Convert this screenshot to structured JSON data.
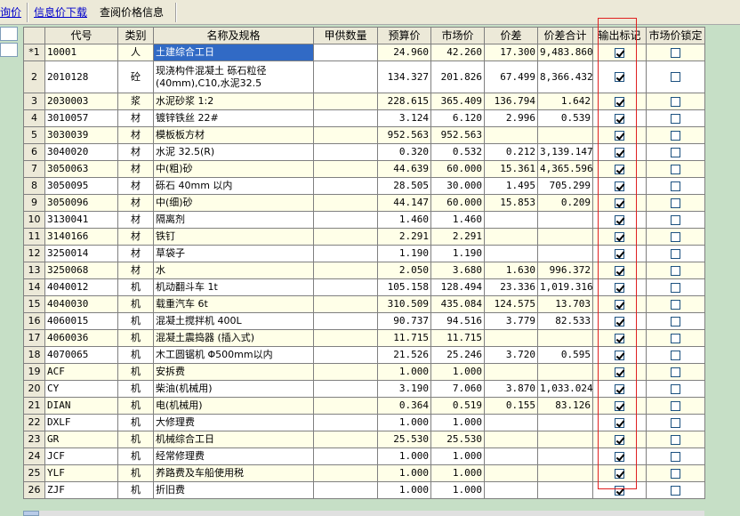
{
  "toolbar": {
    "link1": "询价",
    "link2": "信息价下载",
    "label3": "查阅价格信息"
  },
  "columns": [
    "代号",
    "类别",
    "名称及规格",
    "甲供数量",
    "预算价",
    "市场价",
    "价差",
    "价差合计",
    "输出标记",
    "市场价锁定"
  ],
  "rows": [
    {
      "num": "*1",
      "code": "10001",
      "cat": "人",
      "name": "土建综合工日",
      "budget": "24.960",
      "market": "42.260",
      "diff": "17.300",
      "total": "9,483.860",
      "output": true,
      "lock": false
    },
    {
      "num": "2",
      "code": "2010128",
      "cat": "砼",
      "name": "现浇构件混凝土 砾石粒径(40mm),C10,水泥32.5",
      "budget": "134.327",
      "market": "201.826",
      "diff": "67.499",
      "total": "8,366.432",
      "output": true,
      "lock": false
    },
    {
      "num": "3",
      "code": "2030003",
      "cat": "浆",
      "name": "水泥砂浆 1:2",
      "budget": "228.615",
      "market": "365.409",
      "diff": "136.794",
      "total": "1.642",
      "output": true,
      "lock": false
    },
    {
      "num": "4",
      "code": "3010057",
      "cat": "材",
      "name": "镀锌铁丝 22#",
      "budget": "3.124",
      "market": "6.120",
      "diff": "2.996",
      "total": "0.539",
      "output": true,
      "lock": false
    },
    {
      "num": "5",
      "code": "3030039",
      "cat": "材",
      "name": "模板板方材",
      "budget": "952.563",
      "market": "952.563",
      "diff": "",
      "total": "",
      "output": true,
      "lock": false
    },
    {
      "num": "6",
      "code": "3040020",
      "cat": "材",
      "name": "水泥 32.5(R)",
      "budget": "0.320",
      "market": "0.532",
      "diff": "0.212",
      "total": "3,139.147",
      "output": true,
      "lock": false
    },
    {
      "num": "7",
      "code": "3050063",
      "cat": "材",
      "name": "中(粗)砂",
      "budget": "44.639",
      "market": "60.000",
      "diff": "15.361",
      "total": "4,365.596",
      "output": true,
      "lock": false
    },
    {
      "num": "8",
      "code": "3050095",
      "cat": "材",
      "name": "砾石 40mm 以内",
      "budget": "28.505",
      "market": "30.000",
      "diff": "1.495",
      "total": "705.299",
      "output": true,
      "lock": false
    },
    {
      "num": "9",
      "code": "3050096",
      "cat": "材",
      "name": "中(细)砂",
      "budget": "44.147",
      "market": "60.000",
      "diff": "15.853",
      "total": "0.209",
      "output": true,
      "lock": false
    },
    {
      "num": "10",
      "code": "3130041",
      "cat": "材",
      "name": "隔离剂",
      "budget": "1.460",
      "market": "1.460",
      "diff": "",
      "total": "",
      "output": true,
      "lock": false
    },
    {
      "num": "11",
      "code": "3140166",
      "cat": "材",
      "name": "铁钉",
      "budget": "2.291",
      "market": "2.291",
      "diff": "",
      "total": "",
      "output": true,
      "lock": false
    },
    {
      "num": "12",
      "code": "3250014",
      "cat": "材",
      "name": "草袋子",
      "budget": "1.190",
      "market": "1.190",
      "diff": "",
      "total": "",
      "output": true,
      "lock": false
    },
    {
      "num": "13",
      "code": "3250068",
      "cat": "材",
      "name": "水",
      "budget": "2.050",
      "market": "3.680",
      "diff": "1.630",
      "total": "996.372",
      "output": true,
      "lock": false
    },
    {
      "num": "14",
      "code": "4040012",
      "cat": "机",
      "name": "机动翻斗车 1t",
      "budget": "105.158",
      "market": "128.494",
      "diff": "23.336",
      "total": "1,019.316",
      "output": true,
      "lock": false
    },
    {
      "num": "15",
      "code": "4040030",
      "cat": "机",
      "name": "载重汽车 6t",
      "budget": "310.509",
      "market": "435.084",
      "diff": "124.575",
      "total": "13.703",
      "output": true,
      "lock": false
    },
    {
      "num": "16",
      "code": "4060015",
      "cat": "机",
      "name": "混凝土搅拌机 400L",
      "budget": "90.737",
      "market": "94.516",
      "diff": "3.779",
      "total": "82.533",
      "output": true,
      "lock": false
    },
    {
      "num": "17",
      "code": "4060036",
      "cat": "机",
      "name": "混凝土震捣器 (插入式)",
      "budget": "11.715",
      "market": "11.715",
      "diff": "",
      "total": "",
      "output": true,
      "lock": false
    },
    {
      "num": "18",
      "code": "4070065",
      "cat": "机",
      "name": "木工圆锯机 Φ500mm以内",
      "budget": "21.526",
      "market": "25.246",
      "diff": "3.720",
      "total": "0.595",
      "output": true,
      "lock": false
    },
    {
      "num": "19",
      "code": "ACF",
      "cat": "机",
      "name": "安拆费",
      "budget": "1.000",
      "market": "1.000",
      "diff": "",
      "total": "",
      "output": true,
      "lock": false
    },
    {
      "num": "20",
      "code": "CY",
      "cat": "机",
      "name": "柴油(机械用)",
      "budget": "3.190",
      "market": "7.060",
      "diff": "3.870",
      "total": "1,033.024",
      "output": true,
      "lock": false
    },
    {
      "num": "21",
      "code": "DIAN",
      "cat": "机",
      "name": "电(机械用)",
      "budget": "0.364",
      "market": "0.519",
      "diff": "0.155",
      "total": "83.126",
      "output": true,
      "lock": false
    },
    {
      "num": "22",
      "code": "DXLF",
      "cat": "机",
      "name": "大修理费",
      "budget": "1.000",
      "market": "1.000",
      "diff": "",
      "total": "",
      "output": true,
      "lock": false
    },
    {
      "num": "23",
      "code": "GR",
      "cat": "机",
      "name": "机械综合工日",
      "budget": "25.530",
      "market": "25.530",
      "diff": "",
      "total": "",
      "output": true,
      "lock": false
    },
    {
      "num": "24",
      "code": "JCF",
      "cat": "机",
      "name": "经常修理费",
      "budget": "1.000",
      "market": "1.000",
      "diff": "",
      "total": "",
      "output": true,
      "lock": false
    },
    {
      "num": "25",
      "code": "YLF",
      "cat": "机",
      "name": "养路费及车船使用税",
      "budget": "1.000",
      "market": "1.000",
      "diff": "",
      "total": "",
      "output": true,
      "lock": false
    },
    {
      "num": "26",
      "code": "ZJF",
      "cat": "机",
      "name": "折旧费",
      "budget": "1.000",
      "market": "1.000",
      "diff": "",
      "total": "",
      "output": true,
      "lock": false
    }
  ],
  "colors": {
    "highlight": "#e02020",
    "selection": "#316ac5",
    "background": "#c6dfc6"
  }
}
